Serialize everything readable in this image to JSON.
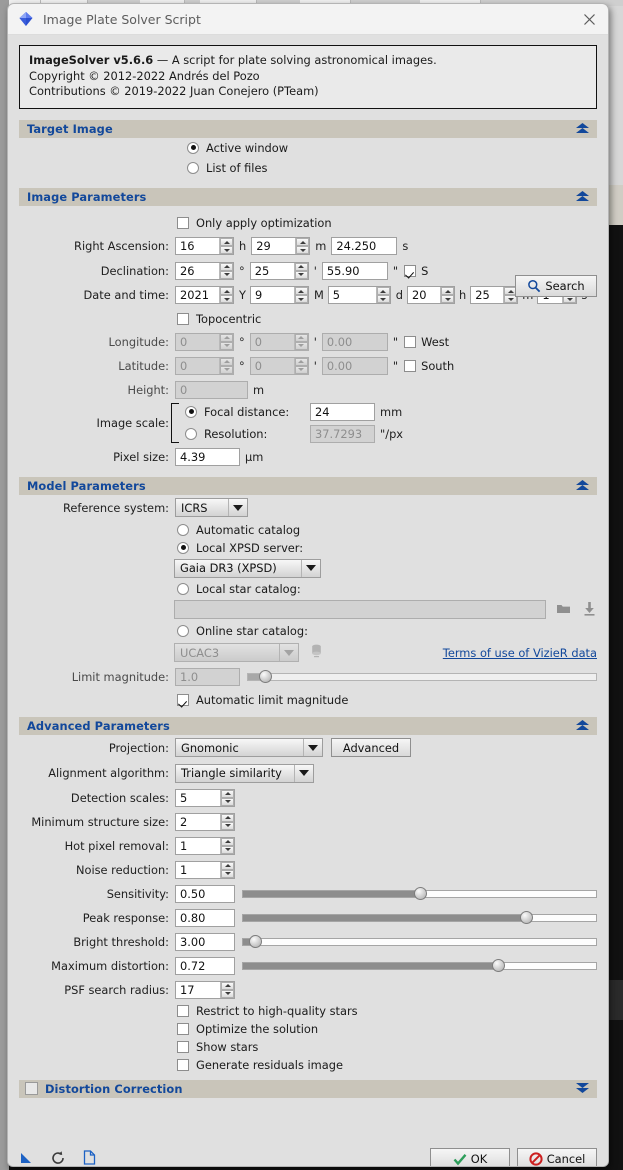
{
  "window": {
    "title": "Image Plate Solver Script",
    "app_icon": "blue-gem-icon",
    "close_icon": "close-icon"
  },
  "about": {
    "product": "ImageSolver v5.6.6",
    "tagline": " — A script for plate solving astronomical images.",
    "copyright": "Copyright © 2012-2022 Andrés del Pozo",
    "contributions": "Contributions © 2019-2022 Juan Conejero (PTeam)"
  },
  "sections": {
    "target_image": {
      "title": "Target Image",
      "collapse_icon": "chevron-double-up-icon"
    },
    "image_parameters": {
      "title": "Image Parameters",
      "collapse_icon": "chevron-double-up-icon"
    },
    "model_parameters": {
      "title": "Model Parameters",
      "collapse_icon": "chevron-double-up-icon"
    },
    "advanced_parameters": {
      "title": "Advanced Parameters",
      "collapse_icon": "chevron-double-up-icon"
    },
    "distortion_correction": {
      "title": "Distortion Correction",
      "collapse_icon": "chevron-double-down-icon",
      "checked": false
    }
  },
  "target_image": {
    "options": [
      {
        "label": "Active window",
        "selected": true
      },
      {
        "label": "List of files",
        "selected": false
      }
    ]
  },
  "image_parameters": {
    "only_apply_optimization": {
      "label": "Only apply optimization",
      "checked": false
    },
    "right_ascension": {
      "label": "Right Ascension:",
      "hours": "16",
      "hours_unit": "h",
      "minutes": "29",
      "minutes_unit": "m",
      "seconds": "24.250",
      "seconds_unit": "s"
    },
    "declination": {
      "label": "Declination:",
      "degrees": "26",
      "degrees_unit": "°",
      "arcmin": "25",
      "arcmin_unit": "'",
      "arcsec": "55.90",
      "arcsec_unit": "\"",
      "south_flag": {
        "label": "S",
        "checked": true
      }
    },
    "date_and_time": {
      "label": "Date and time:",
      "year": "2021",
      "year_unit": "Y",
      "month": "9",
      "month_unit": "M",
      "day": "5",
      "day_unit": "d",
      "hour": "20",
      "hour_unit": "h",
      "minute": "25",
      "minute_unit": "m",
      "second": "1",
      "second_unit": "s"
    },
    "search_button": {
      "label": "Search",
      "icon": "magnifier-icon"
    },
    "topocentric": {
      "label": "Topocentric",
      "checked": false
    },
    "longitude": {
      "label": "Longitude:",
      "degrees": "0",
      "degrees_unit": "°",
      "arcmin": "0",
      "arcmin_unit": "'",
      "arcsec": "0.00",
      "arcsec_unit": "\"",
      "west_flag": {
        "label": "West",
        "checked": false
      }
    },
    "latitude": {
      "label": "Latitude:",
      "degrees": "0",
      "degrees_unit": "°",
      "arcmin": "0",
      "arcmin_unit": "'",
      "arcsec": "0.00",
      "arcsec_unit": "\"",
      "south_flag": {
        "label": "South",
        "checked": false
      }
    },
    "height": {
      "label": "Height:",
      "value": "0",
      "unit": "m"
    },
    "image_scale": {
      "label": "Image scale:",
      "focal_distance": {
        "label": "Focal distance:",
        "value": "24",
        "unit": "mm",
        "selected": true
      },
      "resolution": {
        "label": "Resolution:",
        "value": "37.7293",
        "unit": "\"/px",
        "selected": false
      }
    },
    "pixel_size": {
      "label": "Pixel size:",
      "value": "4.39",
      "unit": "µm"
    }
  },
  "model_parameters": {
    "reference_system": {
      "label": "Reference system:",
      "value": "ICRS"
    },
    "automatic_catalog": {
      "label": "Automatic catalog",
      "selected": false
    },
    "local_xpsd_server": {
      "label": "Local XPSD server:",
      "selected": true,
      "value": "Gaia DR3 (XPSD)"
    },
    "local_star_catalog": {
      "label": "Local star catalog:",
      "selected": false,
      "path": "",
      "browse_icon": "folder-icon",
      "download_icon": "download-arrow-icon"
    },
    "online_star_catalog": {
      "label": "Online star catalog:",
      "selected": false,
      "value": "UCAC3",
      "server_icon": "database-icon"
    },
    "vizier_terms": "Terms of use of VizieR data",
    "limit_magnitude": {
      "label": "Limit magnitude:",
      "value": "1.0",
      "slider_percent": 5,
      "disabled": true
    },
    "automatic_limit_magnitude": {
      "label": "Automatic limit magnitude",
      "checked": true
    }
  },
  "advanced_parameters": {
    "projection": {
      "label": "Projection:",
      "value": "Gnomonic"
    },
    "advanced_button": {
      "label": "Advanced"
    },
    "alignment_algorithm": {
      "label": "Alignment algorithm:",
      "value": "Triangle similarity"
    },
    "detection_scales": {
      "label": "Detection scales:",
      "value": "5"
    },
    "minimum_structure_size": {
      "label": "Minimum structure size:",
      "value": "2"
    },
    "hot_pixel_removal": {
      "label": "Hot pixel removal:",
      "value": "1"
    },
    "noise_reduction": {
      "label": "Noise reduction:",
      "value": "1"
    },
    "sensitivity": {
      "label": "Sensitivity:",
      "value": "0.50",
      "slider_percent": 50
    },
    "peak_response": {
      "label": "Peak response:",
      "value": "0.80",
      "slider_percent": 80
    },
    "bright_threshold": {
      "label": "Bright threshold:",
      "value": "3.00",
      "slider_percent": 3
    },
    "maximum_distortion": {
      "label": "Maximum distortion:",
      "value": "0.72",
      "slider_percent": 72
    },
    "psf_search_radius": {
      "label": "PSF search radius:",
      "value": "17"
    },
    "checkboxes": [
      {
        "label": "Restrict to high-quality stars",
        "checked": false
      },
      {
        "label": "Optimize the solution",
        "checked": false
      },
      {
        "label": "Show stars",
        "checked": false
      },
      {
        "label": "Generate residuals image",
        "checked": false
      }
    ]
  },
  "footer": {
    "icons": [
      {
        "name": "pointer-arrow-icon"
      },
      {
        "name": "reset-icon"
      },
      {
        "name": "document-icon"
      }
    ],
    "ok_button": {
      "label": "OK",
      "icon": "check-icon"
    },
    "cancel_button": {
      "label": "Cancel",
      "icon": "prohibition-icon"
    }
  },
  "colors": {
    "accent_blue": "#12489b",
    "section_bar": "#c9c5ba",
    "dialog_bg": "#e0e0e0",
    "ok_green": "#2e9e5b",
    "cancel_red": "#cc2020"
  }
}
